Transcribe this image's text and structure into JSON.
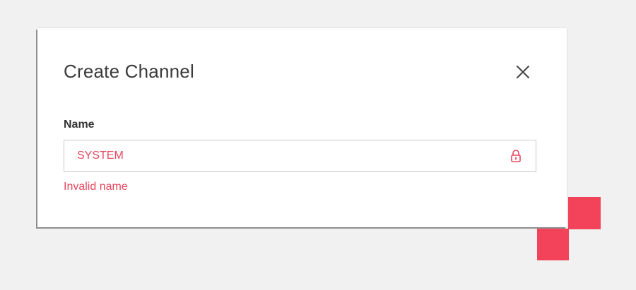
{
  "dialog": {
    "title": "Create Channel",
    "close_icon": "close-icon",
    "name_field": {
      "label": "Name",
      "value": "SYSTEM",
      "lock_icon": "lock-icon",
      "error": "Invalid name"
    }
  },
  "colors": {
    "error": "#e8475f",
    "accent": "#f2435b",
    "backdrop": "#f1f1f1"
  }
}
